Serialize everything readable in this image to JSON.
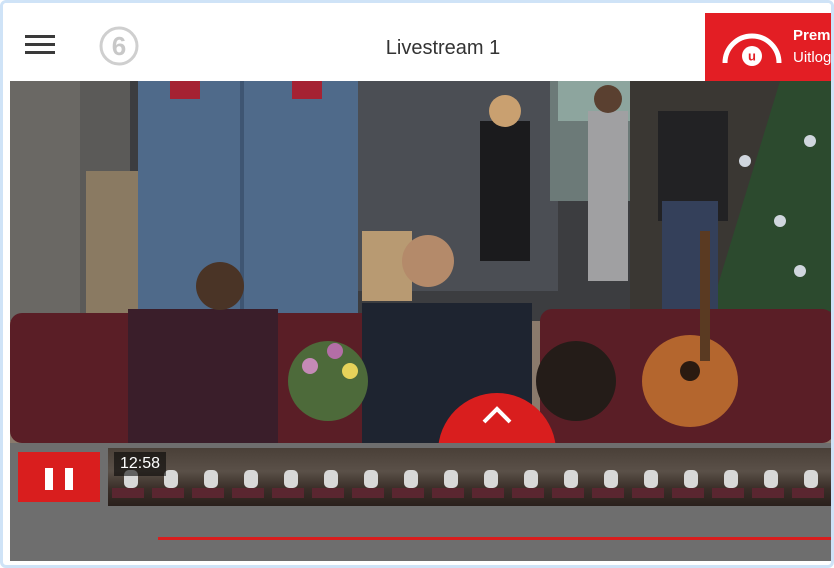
{
  "header": {
    "menu_icon": "hamburger-menu-icon",
    "logo_text": "6",
    "title": "Livestream 1",
    "premium": {
      "title": "Prem",
      "subtitle": "Uitlog",
      "logo_letter": "u"
    }
  },
  "player": {
    "timecode": "12:58",
    "state": "playing",
    "expand_icon": "chevron-up-icon",
    "pause_icon": "pause-icon"
  },
  "colors": {
    "accent": "#d91e1e",
    "premium_bg": "#e31e24",
    "controls_bg": "#6e6e6e",
    "header_bg": "#ffffff"
  }
}
